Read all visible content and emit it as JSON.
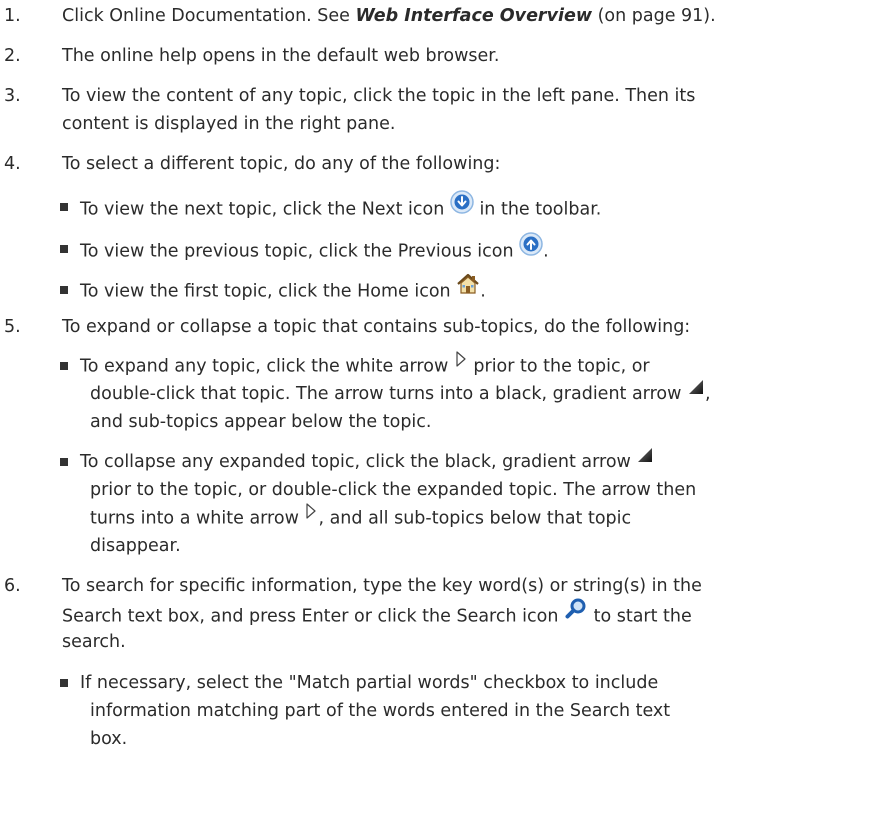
{
  "steps": [
    {
      "num": "1.",
      "pre": "Click Online Documentation. See ",
      "link": "Web Interface Overview",
      "post": " (on page 91)."
    },
    {
      "num": "2.",
      "text": "The online help opens in the default web browser."
    },
    {
      "num": "3.",
      "line1": "To view the content of any topic, click the topic in the left pane. Then its",
      "line2": "content is displayed in the right pane."
    },
    {
      "num": "4.",
      "text": "To select a different topic, do any of the following:"
    },
    {
      "num": "5.",
      "text": "To expand or collapse a topic that contains sub-topics, do the following:"
    },
    {
      "num": "6.",
      "line1": "To search for specific information, type the key word(s) or string(s) in the",
      "line2a": "Search text box, and press Enter or click the Search icon",
      "line2b": " to start the",
      "line3": "search."
    }
  ],
  "step4_bullets": [
    {
      "pre": "To view the next topic, click the Next icon ",
      "post": " in the toolbar.",
      "icon": "next-circle-icon"
    },
    {
      "pre": "To view the previous topic, click the Previous icon ",
      "post": ".",
      "icon": "previous-circle-icon"
    },
    {
      "pre": "To view the first topic, click the Home icon ",
      "post": ".",
      "icon": "home-icon"
    }
  ],
  "step5_bullets": [
    {
      "l1a": "To expand any topic, click the white arrow ",
      "l1b": " prior to the topic, or",
      "l2a": "double-click that topic. The arrow turns into a black, gradient arrow ",
      "l2b": ",",
      "l3": "and sub-topics appear below the topic."
    },
    {
      "l1a": "To collapse any expanded topic, click the black, gradient arrow ",
      "l2": "prior to the topic, or double-click the expanded topic. The arrow then",
      "l3a": "turns into a white arrow ",
      "l3b": ", and all sub-topics below that topic",
      "l4": "disappear."
    }
  ],
  "step6_bullets": [
    {
      "l1": "If necessary, select the \"Match partial words\" checkbox to include",
      "l2": "information matching part of the words entered in the Search text",
      "l3": "box."
    }
  ],
  "colors": {
    "text": "#2b2b2b",
    "icon_blue": "#2a6fc4",
    "icon_ring": "#9cc3ea"
  }
}
